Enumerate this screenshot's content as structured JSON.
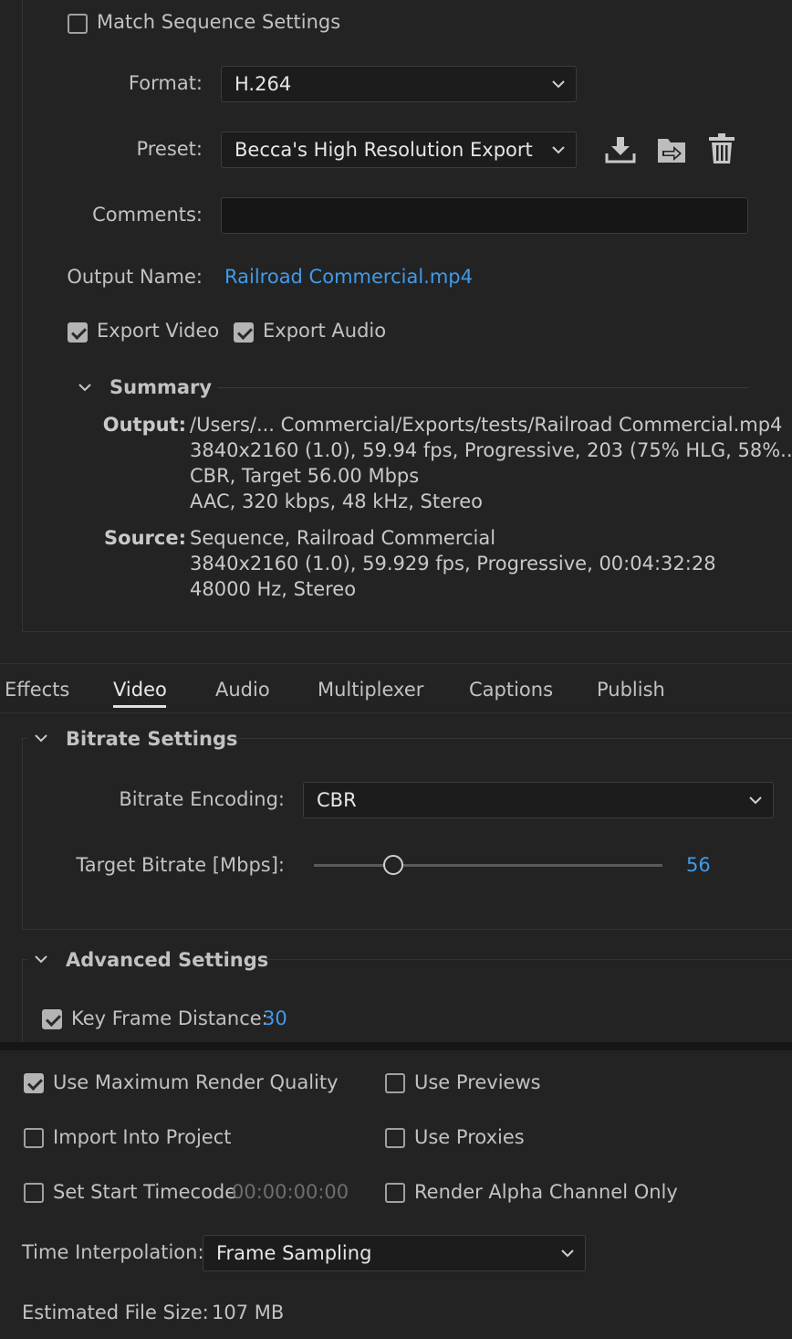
{
  "match_sequence_settings": {
    "label": "Match Sequence Settings",
    "checked": false
  },
  "format": {
    "label": "Format:",
    "value": "H.264"
  },
  "preset": {
    "label": "Preset:",
    "value": "Becca's High Resolution Export"
  },
  "comments": {
    "label": "Comments:",
    "value": ""
  },
  "output_name": {
    "label": "Output Name:",
    "value": "Railroad Commercial.mp4"
  },
  "export_video": {
    "label": "Export Video",
    "checked": true
  },
  "export_audio": {
    "label": "Export Audio",
    "checked": true
  },
  "summary": {
    "title": "Summary",
    "output_label": "Output:",
    "output_lines": [
      "/Users/... Commercial/Exports/tests/Railroad Commercial.mp4",
      "3840x2160 (1.0), 59.94 fps, Progressive, 203 (75% HLG, 58%...",
      "CBR, Target 56.00 Mbps",
      "AAC, 320 kbps, 48 kHz, Stereo"
    ],
    "source_label": "Source:",
    "source_lines": [
      "Sequence, Railroad Commercial",
      "3840x2160 (1.0), 59.929 fps, Progressive, 00:04:32:28",
      "48000 Hz, Stereo"
    ]
  },
  "tabs": [
    "Effects",
    "Video",
    "Audio",
    "Multiplexer",
    "Captions",
    "Publish"
  ],
  "active_tab": "Video",
  "bitrate_settings": {
    "title": "Bitrate Settings",
    "encoding_label": "Bitrate Encoding:",
    "encoding_value": "CBR",
    "target_label": "Target Bitrate [Mbps]:",
    "target_value": "56"
  },
  "advanced_settings": {
    "title": "Advanced Settings",
    "key_frame_label": "Key Frame Distance:",
    "key_frame_checked": true,
    "key_frame_value": "30"
  },
  "options": {
    "max_render_quality": {
      "label": "Use Maximum Render Quality",
      "checked": true
    },
    "use_previews": {
      "label": "Use Previews",
      "checked": false
    },
    "import_into_project": {
      "label": "Import Into Project",
      "checked": false
    },
    "use_proxies": {
      "label": "Use Proxies",
      "checked": false
    },
    "set_start_timecode": {
      "label": "Set Start Timecode",
      "checked": false,
      "timecode": "00:00:00:00"
    },
    "render_alpha_only": {
      "label": "Render Alpha Channel Only",
      "checked": false
    }
  },
  "time_interpolation": {
    "label": "Time Interpolation:",
    "value": "Frame Sampling"
  },
  "estimated_file_size": {
    "label": "Estimated File Size:",
    "value": "107 MB"
  },
  "colors": {
    "background": "#232323",
    "accent": "#3f9bec",
    "text": "#c9c9c9"
  }
}
